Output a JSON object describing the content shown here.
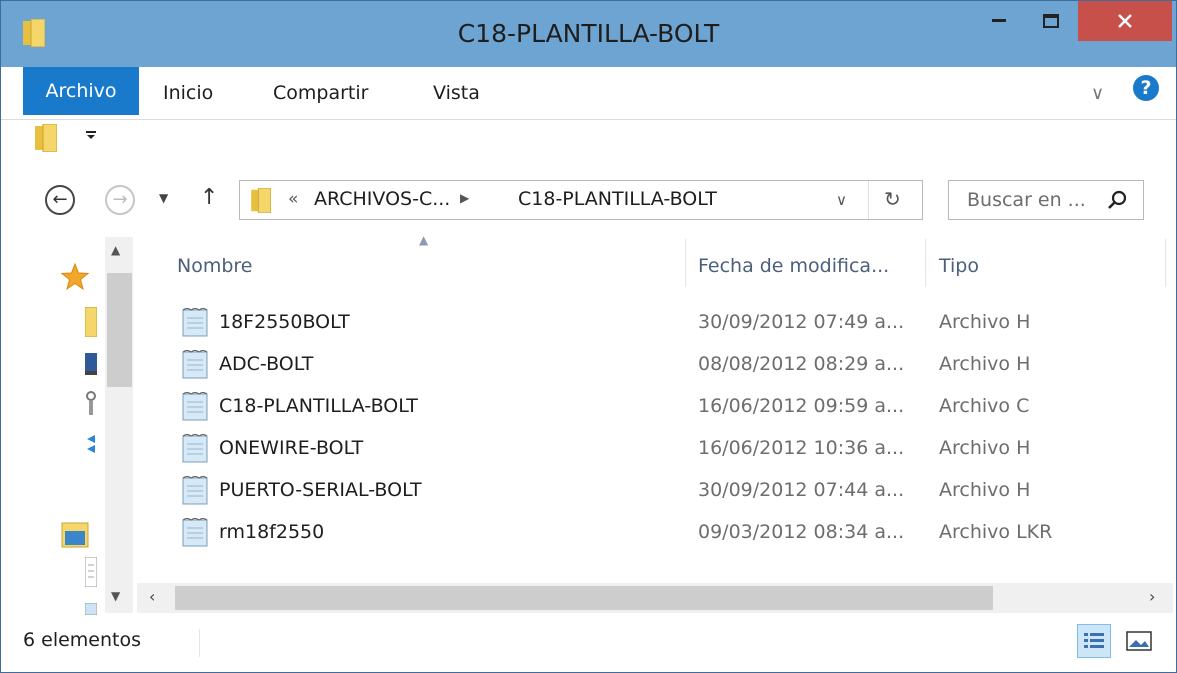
{
  "window": {
    "title": "C18-PLANTILLA-BOLT"
  },
  "ribbon": {
    "tabs": [
      "Archivo",
      "Inicio",
      "Compartir",
      "Vista"
    ],
    "help": "?"
  },
  "address": {
    "crumbs": [
      "ARCHIVOS-C...",
      "C18-PLANTILLA-BOLT"
    ],
    "overflow": "«"
  },
  "search": {
    "placeholder": "Buscar en ..."
  },
  "columns": {
    "name": "Nombre",
    "date": "Fecha de modifica...",
    "type": "Tipo"
  },
  "files": [
    {
      "name": "18F2550BOLT",
      "date": "30/09/2012 07:49 a...",
      "type": "Archivo H"
    },
    {
      "name": "ADC-BOLT",
      "date": "08/08/2012 08:29 a...",
      "type": "Archivo H"
    },
    {
      "name": "C18-PLANTILLA-BOLT",
      "date": "16/06/2012 09:59 a...",
      "type": "Archivo C"
    },
    {
      "name": "ONEWIRE-BOLT",
      "date": "16/06/2012 10:36 a...",
      "type": "Archivo H"
    },
    {
      "name": "PUERTO-SERIAL-BOLT",
      "date": "30/09/2012 07:44 a...",
      "type": "Archivo H"
    },
    {
      "name": "rm18f2550",
      "date": "09/03/2012 08:34 a...",
      "type": "Archivo LKR"
    }
  ],
  "status": {
    "count": "6 elementos"
  },
  "icons": {
    "folder": "folder-icon",
    "file": "text-file-icon",
    "search": "search-icon",
    "refresh": "refresh-icon"
  },
  "colors": {
    "titlebar": "#6ea4d1",
    "accent": "#1979ca",
    "close": "#c7504a"
  }
}
